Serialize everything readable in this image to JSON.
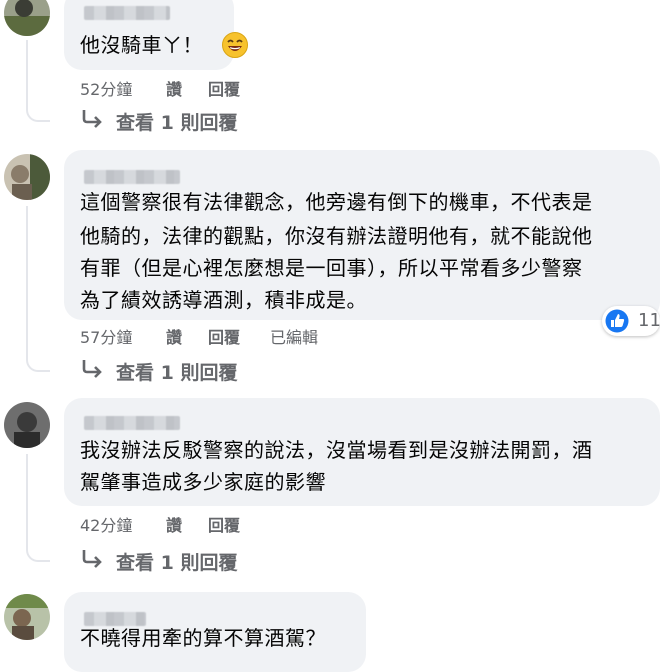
{
  "colors": {
    "bubble": "#f0f2f5",
    "meta_text": "#65676b",
    "body_text": "#050505",
    "like_blue": "#1877f2"
  },
  "comments": [
    {
      "text_lines": [
        "他沒騎車ㄚ！"
      ],
      "emoji": "grinning-face-icon",
      "time": "52分鐘",
      "like": "讚",
      "reply": "回覆",
      "view_replies": "查看 1 則回覆"
    },
    {
      "text_lines": [
        "這個警察很有法律觀念，他旁邊有倒下的機車，不代表是",
        "他騎的，法律的觀點，你沒有辦法證明他有，就不能說他",
        "有罪（但是心裡怎麼想是一回事），所以平常看多少警察",
        "為了績效誘導酒測，積非成是。"
      ],
      "time": "57分鐘",
      "like": "讚",
      "reply": "回覆",
      "edited": "已編輯",
      "reaction_count": "11",
      "view_replies": "查看 1 則回覆"
    },
    {
      "text_lines": [
        "我沒辦法反駁警察的說法，沒當場看到是沒辦法開罰，酒",
        "駕肇事造成多少家庭的影響"
      ],
      "time": "42分鐘",
      "like": "讚",
      "reply": "回覆",
      "view_replies": "查看 1 則回覆"
    },
    {
      "text_lines": [
        "不曉得用牽的算不算酒駕？"
      ]
    }
  ]
}
